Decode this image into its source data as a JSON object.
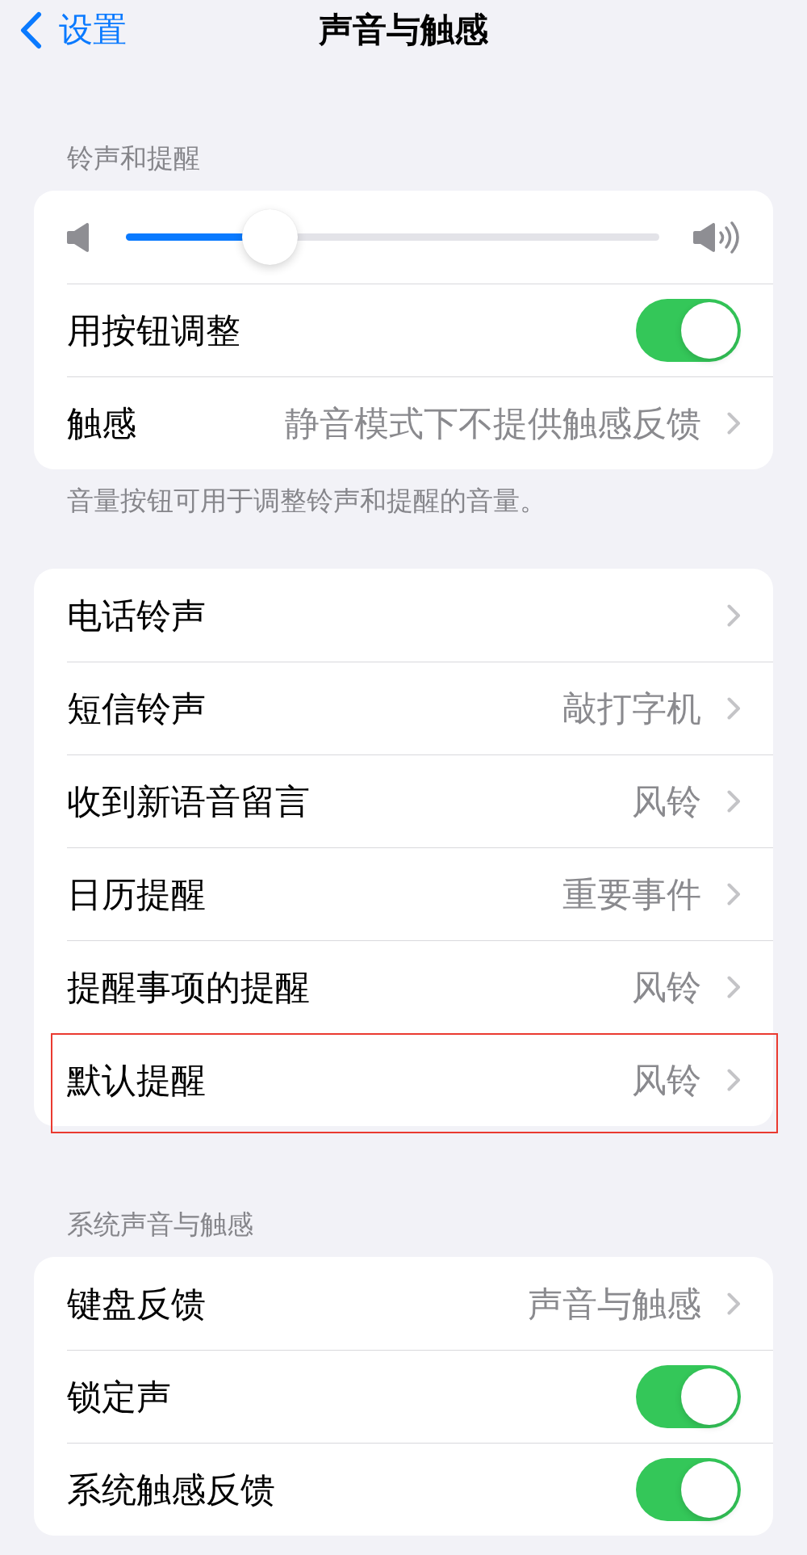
{
  "nav": {
    "back_label": "设置",
    "title": "声音与触感"
  },
  "sections": [
    {
      "header": "铃声和提醒",
      "rows": [
        {
          "kind": "slider",
          "level": 0.27,
          "highlighted": false
        },
        {
          "kind": "toggle",
          "label": "用按钮调整",
          "on": true,
          "highlighted": false
        },
        {
          "kind": "link",
          "label": "触感",
          "value": "静音模式下不提供触感反馈",
          "highlighted": false
        }
      ],
      "footer": "音量按钮可用于调整铃声和提醒的音量。"
    },
    {
      "rows": [
        {
          "kind": "link",
          "label": "电话铃声",
          "highlighted": false
        },
        {
          "kind": "link",
          "label": "短信铃声",
          "value": "敲打字机",
          "highlighted": false
        },
        {
          "kind": "link",
          "label": "收到新语音留言",
          "value": "风铃",
          "highlighted": false
        },
        {
          "kind": "link",
          "label": "日历提醒",
          "value": "重要事件",
          "highlighted": false
        },
        {
          "kind": "link",
          "label": "提醒事项的提醒",
          "value": "风铃",
          "highlighted": false
        },
        {
          "kind": "link",
          "label": "默认提醒",
          "value": "风铃",
          "highlighted": true
        }
      ]
    },
    {
      "header": "系统声音与触感",
      "rows": [
        {
          "kind": "link",
          "label": "键盘反馈",
          "value": "声音与触感",
          "highlighted": false
        },
        {
          "kind": "toggle",
          "label": "锁定声",
          "on": true,
          "highlighted": false
        },
        {
          "kind": "toggle",
          "label": "系统触感反馈",
          "on": true,
          "highlighted": false
        }
      ]
    }
  ]
}
